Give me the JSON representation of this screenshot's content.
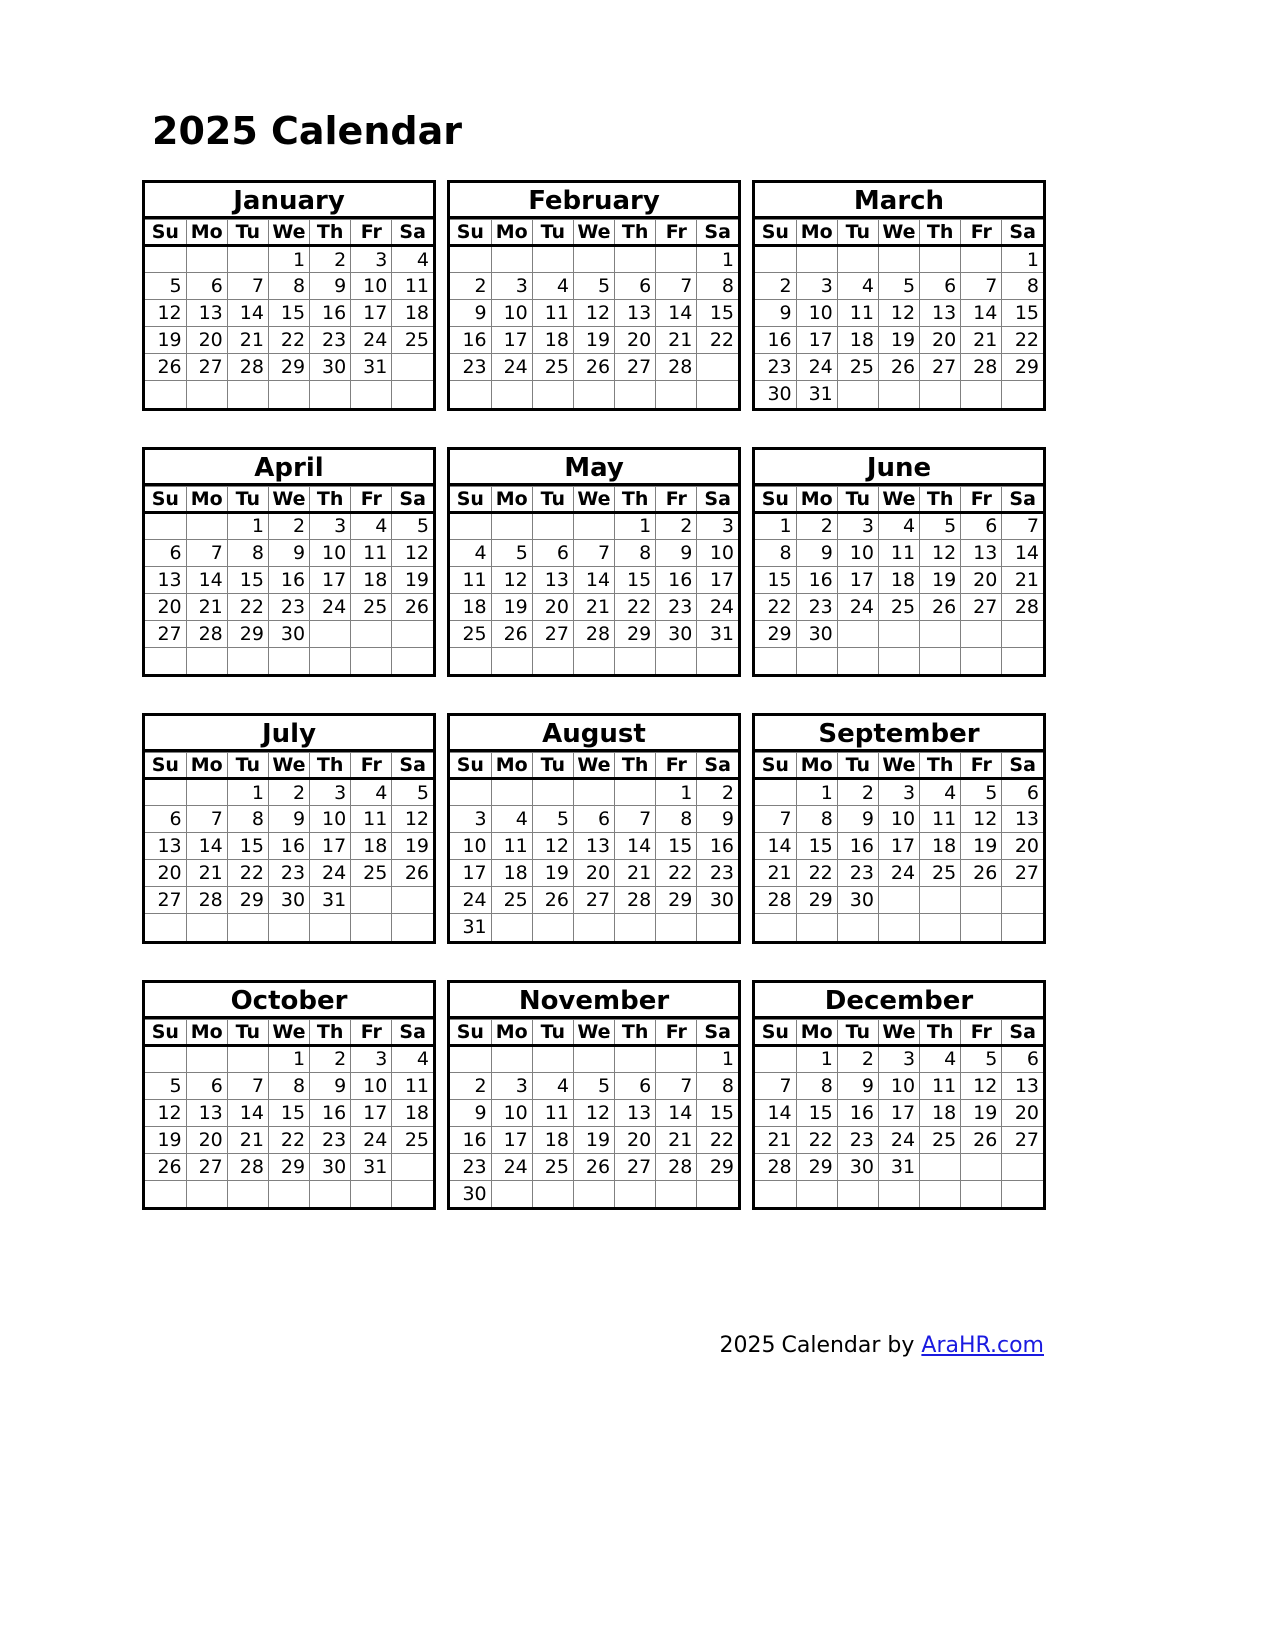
{
  "page": {
    "title": "2025 Calendar",
    "year": "2025"
  },
  "weekday_headers": [
    "Su",
    "Mo",
    "Tu",
    "We",
    "Th",
    "Fr",
    "Sa"
  ],
  "footer": {
    "year": "2025",
    "text": "Calendar by",
    "link_label": "AraHR.com",
    "link_color": "#1a1ae0"
  },
  "colors": {
    "border": "#000000",
    "grid_line": "#808080",
    "text": "#000000",
    "background": "#ffffff",
    "link": "#1a1ae0"
  },
  "months": [
    {
      "name": "January",
      "weeks": [
        [
          "",
          "",
          "",
          "1",
          "2",
          "3",
          "4"
        ],
        [
          "5",
          "6",
          "7",
          "8",
          "9",
          "10",
          "11"
        ],
        [
          "12",
          "13",
          "14",
          "15",
          "16",
          "17",
          "18"
        ],
        [
          "19",
          "20",
          "21",
          "22",
          "23",
          "24",
          "25"
        ],
        [
          "26",
          "27",
          "28",
          "29",
          "30",
          "31",
          ""
        ],
        [
          "",
          "",
          "",
          "",
          "",
          "",
          ""
        ]
      ]
    },
    {
      "name": "February",
      "weeks": [
        [
          "",
          "",
          "",
          "",
          "",
          "",
          "1"
        ],
        [
          "2",
          "3",
          "4",
          "5",
          "6",
          "7",
          "8"
        ],
        [
          "9",
          "10",
          "11",
          "12",
          "13",
          "14",
          "15"
        ],
        [
          "16",
          "17",
          "18",
          "19",
          "20",
          "21",
          "22"
        ],
        [
          "23",
          "24",
          "25",
          "26",
          "27",
          "28",
          ""
        ],
        [
          "",
          "",
          "",
          "",
          "",
          "",
          ""
        ]
      ]
    },
    {
      "name": "March",
      "weeks": [
        [
          "",
          "",
          "",
          "",
          "",
          "",
          "1"
        ],
        [
          "2",
          "3",
          "4",
          "5",
          "6",
          "7",
          "8"
        ],
        [
          "9",
          "10",
          "11",
          "12",
          "13",
          "14",
          "15"
        ],
        [
          "16",
          "17",
          "18",
          "19",
          "20",
          "21",
          "22"
        ],
        [
          "23",
          "24",
          "25",
          "26",
          "27",
          "28",
          "29"
        ],
        [
          "30",
          "31",
          "",
          "",
          "",
          "",
          ""
        ]
      ]
    },
    {
      "name": "April",
      "weeks": [
        [
          "",
          "",
          "1",
          "2",
          "3",
          "4",
          "5"
        ],
        [
          "6",
          "7",
          "8",
          "9",
          "10",
          "11",
          "12"
        ],
        [
          "13",
          "14",
          "15",
          "16",
          "17",
          "18",
          "19"
        ],
        [
          "20",
          "21",
          "22",
          "23",
          "24",
          "25",
          "26"
        ],
        [
          "27",
          "28",
          "29",
          "30",
          "",
          "",
          ""
        ],
        [
          "",
          "",
          "",
          "",
          "",
          "",
          ""
        ]
      ]
    },
    {
      "name": "May",
      "weeks": [
        [
          "",
          "",
          "",
          "",
          "1",
          "2",
          "3"
        ],
        [
          "4",
          "5",
          "6",
          "7",
          "8",
          "9",
          "10"
        ],
        [
          "11",
          "12",
          "13",
          "14",
          "15",
          "16",
          "17"
        ],
        [
          "18",
          "19",
          "20",
          "21",
          "22",
          "23",
          "24"
        ],
        [
          "25",
          "26",
          "27",
          "28",
          "29",
          "30",
          "31"
        ],
        [
          "",
          "",
          "",
          "",
          "",
          "",
          ""
        ]
      ]
    },
    {
      "name": "June",
      "weeks": [
        [
          "1",
          "2",
          "3",
          "4",
          "5",
          "6",
          "7"
        ],
        [
          "8",
          "9",
          "10",
          "11",
          "12",
          "13",
          "14"
        ],
        [
          "15",
          "16",
          "17",
          "18",
          "19",
          "20",
          "21"
        ],
        [
          "22",
          "23",
          "24",
          "25",
          "26",
          "27",
          "28"
        ],
        [
          "29",
          "30",
          "",
          "",
          "",
          "",
          ""
        ],
        [
          "",
          "",
          "",
          "",
          "",
          "",
          ""
        ]
      ]
    },
    {
      "name": "July",
      "weeks": [
        [
          "",
          "",
          "1",
          "2",
          "3",
          "4",
          "5"
        ],
        [
          "6",
          "7",
          "8",
          "9",
          "10",
          "11",
          "12"
        ],
        [
          "13",
          "14",
          "15",
          "16",
          "17",
          "18",
          "19"
        ],
        [
          "20",
          "21",
          "22",
          "23",
          "24",
          "25",
          "26"
        ],
        [
          "27",
          "28",
          "29",
          "30",
          "31",
          "",
          ""
        ],
        [
          "",
          "",
          "",
          "",
          "",
          "",
          ""
        ]
      ]
    },
    {
      "name": "August",
      "weeks": [
        [
          "",
          "",
          "",
          "",
          "",
          "1",
          "2"
        ],
        [
          "3",
          "4",
          "5",
          "6",
          "7",
          "8",
          "9"
        ],
        [
          "10",
          "11",
          "12",
          "13",
          "14",
          "15",
          "16"
        ],
        [
          "17",
          "18",
          "19",
          "20",
          "21",
          "22",
          "23"
        ],
        [
          "24",
          "25",
          "26",
          "27",
          "28",
          "29",
          "30"
        ],
        [
          "31",
          "",
          "",
          "",
          "",
          "",
          ""
        ]
      ]
    },
    {
      "name": "September",
      "weeks": [
        [
          "",
          "1",
          "2",
          "3",
          "4",
          "5",
          "6"
        ],
        [
          "7",
          "8",
          "9",
          "10",
          "11",
          "12",
          "13"
        ],
        [
          "14",
          "15",
          "16",
          "17",
          "18",
          "19",
          "20"
        ],
        [
          "21",
          "22",
          "23",
          "24",
          "25",
          "26",
          "27"
        ],
        [
          "28",
          "29",
          "30",
          "",
          "",
          "",
          ""
        ],
        [
          "",
          "",
          "",
          "",
          "",
          "",
          ""
        ]
      ]
    },
    {
      "name": "October",
      "weeks": [
        [
          "",
          "",
          "",
          "1",
          "2",
          "3",
          "4"
        ],
        [
          "5",
          "6",
          "7",
          "8",
          "9",
          "10",
          "11"
        ],
        [
          "12",
          "13",
          "14",
          "15",
          "16",
          "17",
          "18"
        ],
        [
          "19",
          "20",
          "21",
          "22",
          "23",
          "24",
          "25"
        ],
        [
          "26",
          "27",
          "28",
          "29",
          "30",
          "31",
          ""
        ],
        [
          "",
          "",
          "",
          "",
          "",
          "",
          ""
        ]
      ]
    },
    {
      "name": "November",
      "weeks": [
        [
          "",
          "",
          "",
          "",
          "",
          "",
          "1"
        ],
        [
          "2",
          "3",
          "4",
          "5",
          "6",
          "7",
          "8"
        ],
        [
          "9",
          "10",
          "11",
          "12",
          "13",
          "14",
          "15"
        ],
        [
          "16",
          "17",
          "18",
          "19",
          "20",
          "21",
          "22"
        ],
        [
          "23",
          "24",
          "25",
          "26",
          "27",
          "28",
          "29"
        ],
        [
          "30",
          "",
          "",
          "",
          "",
          "",
          ""
        ]
      ]
    },
    {
      "name": "December",
      "weeks": [
        [
          "",
          "1",
          "2",
          "3",
          "4",
          "5",
          "6"
        ],
        [
          "7",
          "8",
          "9",
          "10",
          "11",
          "12",
          "13"
        ],
        [
          "14",
          "15",
          "16",
          "17",
          "18",
          "19",
          "20"
        ],
        [
          "21",
          "22",
          "23",
          "24",
          "25",
          "26",
          "27"
        ],
        [
          "28",
          "29",
          "30",
          "31",
          "",
          "",
          ""
        ],
        [
          "",
          "",
          "",
          "",
          "",
          "",
          ""
        ]
      ]
    }
  ]
}
